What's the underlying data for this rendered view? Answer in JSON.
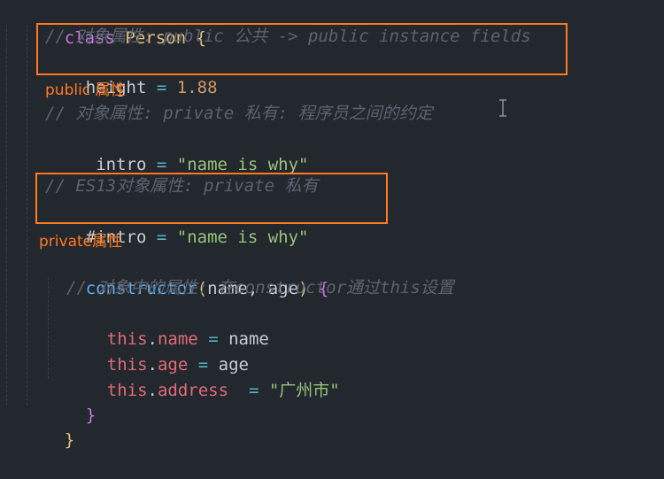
{
  "code": {
    "class_keyword": "class",
    "class_name": "Person",
    "open_brace": "{",
    "comment_public": "// 对象属性: public 公共 -> public instance fields",
    "height_name": "height",
    "equals": "=",
    "height_value": "1.88",
    "comment_private": "// 对象属性: private 私有: 程序员之间的约定",
    "intro_name": "_intro",
    "intro_value": "\"name is why\"",
    "comment_es13": "// ES13对象属性: private 私有",
    "hash_intro_name": "#intro",
    "hash_intro_value": "\"name is why\"",
    "constructor_keyword": "constructor",
    "paren_open": "(",
    "param_name": "name",
    "comma": ", ",
    "param_age": "age",
    "paren_close": ")",
    "ctor_open_brace": "{",
    "comment_ctor": "// 对象中的属性: 在constructor通过this设置",
    "this_kw": "this",
    "dot": ".",
    "prop_name": "name",
    "val_name": "name",
    "prop_age": "age",
    "val_age": "age",
    "prop_address": "address",
    "val_address": "\"广州市\"",
    "ctor_close_brace": "}",
    "class_close_brace": "}"
  },
  "annotations": {
    "public_label": "public 属性",
    "private_label": "private属性"
  },
  "colors": {
    "highlight_box": "#ff7a1f",
    "background": "#23272e"
  },
  "cursor_icon": "text-cursor-icon"
}
